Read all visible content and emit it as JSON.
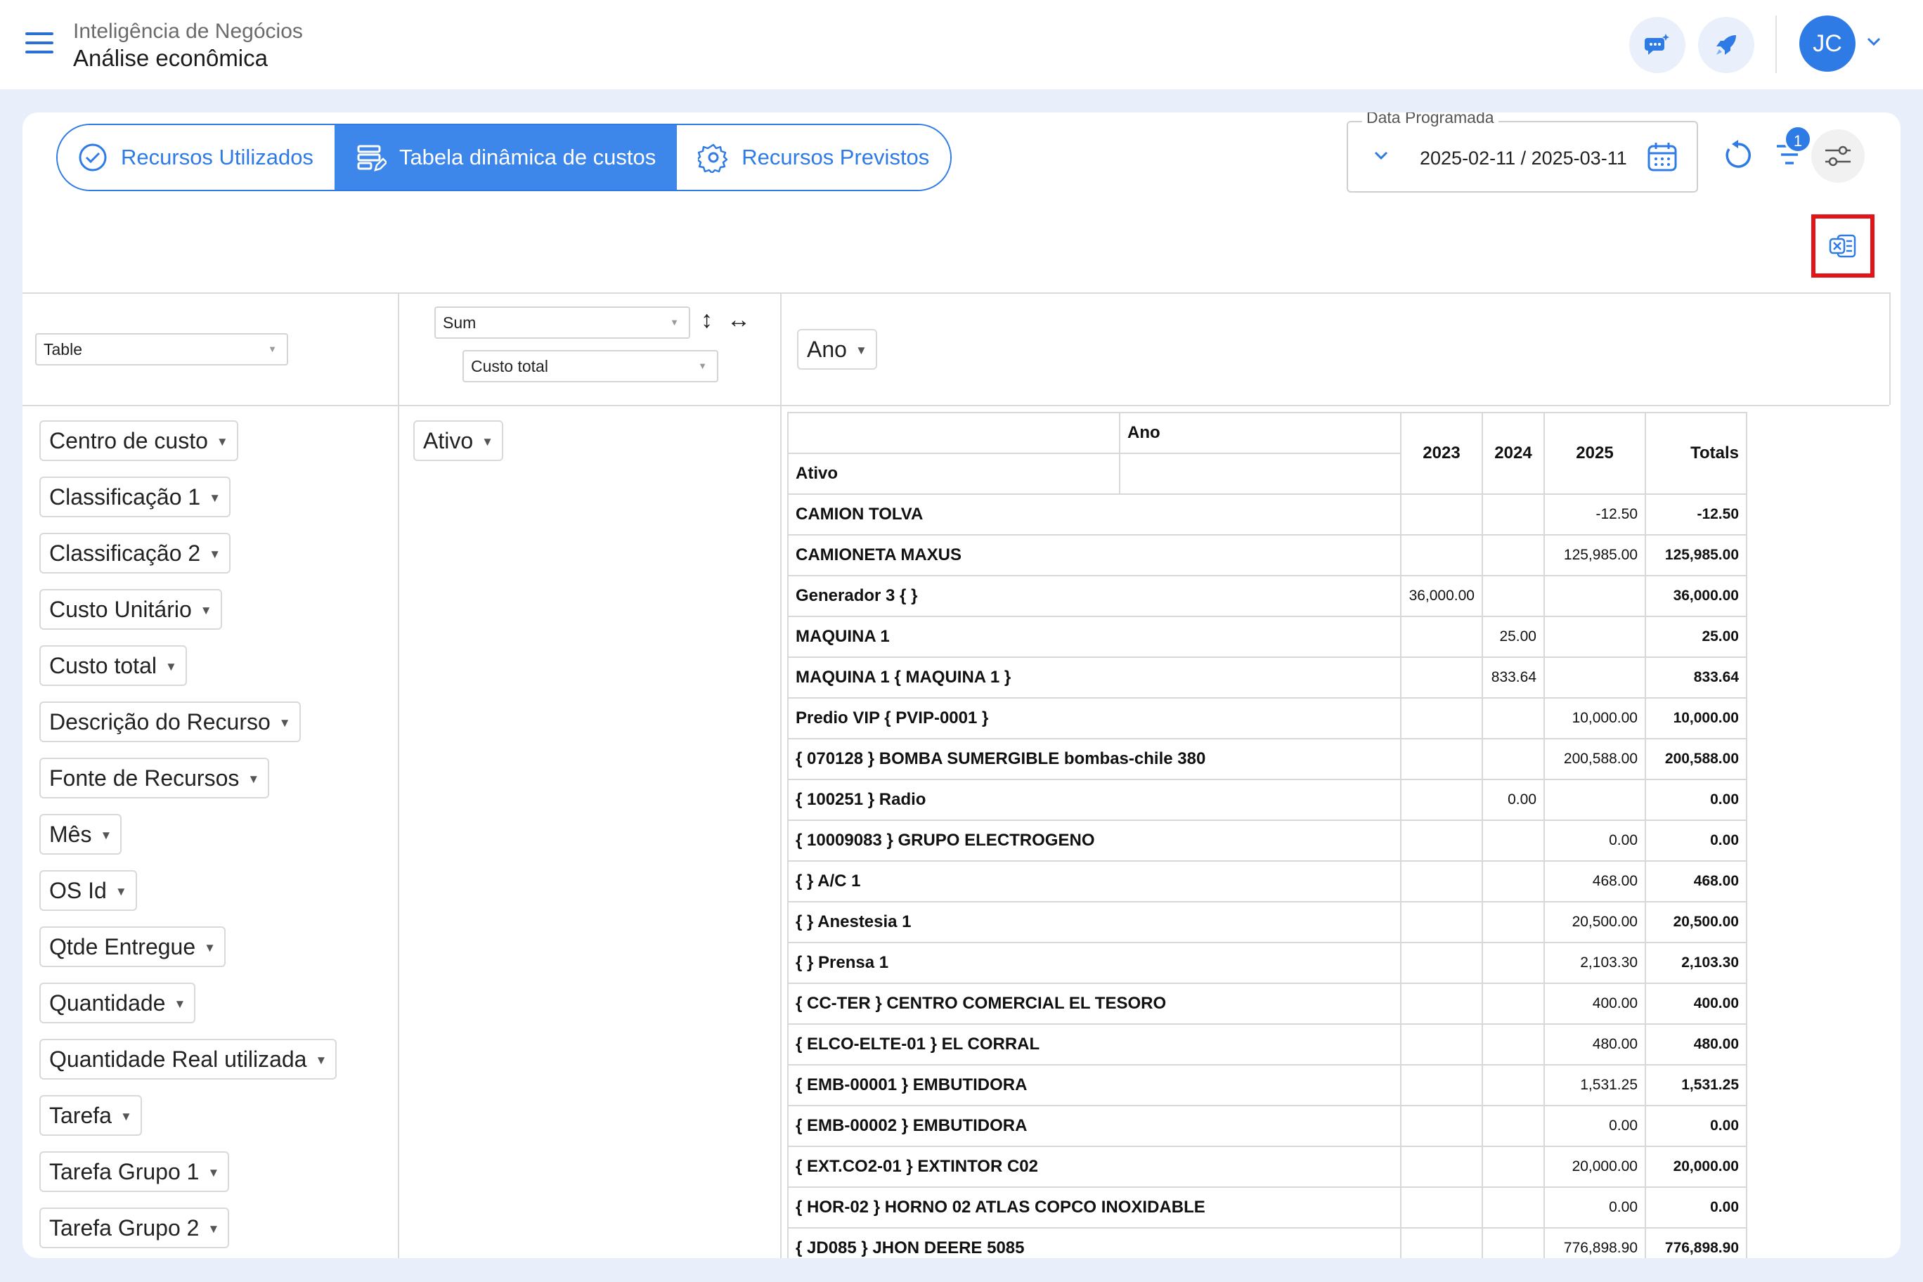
{
  "header": {
    "subtitle": "Inteligência de Negócios",
    "title": "Análise econômica",
    "avatar_initials": "JC"
  },
  "tabs": [
    {
      "label": "Recursos Utilizados",
      "icon": "check-circle-icon",
      "active": false
    },
    {
      "label": "Tabela dinâmica de custos",
      "icon": "table-edit-icon",
      "active": true
    },
    {
      "label": "Recursos Previstos",
      "icon": "gear-icon",
      "active": false
    }
  ],
  "date_filter": {
    "label": "Data Programada",
    "value": "2025-02-11 / 2025-03-11"
  },
  "filter_badge": "1",
  "pivot": {
    "renderer": "Table",
    "aggregator": "Sum",
    "value_field": "Custo total",
    "column_field": "Ano",
    "row_field": "Ativo",
    "available_fields": [
      "Centro de custo",
      "Classificação 1",
      "Classificação 2",
      "Custo Unitário",
      "Custo total",
      "Descrição do Recurso",
      "Fonte de Recursos",
      "Mês",
      "OS Id",
      "Qtde Entregue",
      "Quantidade",
      "Quantidade Real utilizada",
      "Tarefa",
      "Tarefa Grupo 1",
      "Tarefa Grupo 2"
    ]
  },
  "table": {
    "col_attr_label": "Ano",
    "row_attr_label": "Ativo",
    "columns": [
      "2023",
      "2024",
      "2025"
    ],
    "totals_label": "Totals",
    "rows": [
      {
        "label": "CAMION TOLVA",
        "v2023": "",
        "v2024": "",
        "v2025": "-12.50",
        "total": "-12.50"
      },
      {
        "label": "CAMIONETA MAXUS",
        "v2023": "",
        "v2024": "",
        "v2025": "125,985.00",
        "total": "125,985.00"
      },
      {
        "label": "Generador 3 { }",
        "v2023": "36,000.00",
        "v2024": "",
        "v2025": "",
        "total": "36,000.00"
      },
      {
        "label": "MAQUINA 1",
        "v2023": "",
        "v2024": "25.00",
        "v2025": "",
        "total": "25.00"
      },
      {
        "label": "MAQUINA 1 { MAQUINA 1 }",
        "v2023": "",
        "v2024": "833.64",
        "v2025": "",
        "total": "833.64"
      },
      {
        "label": "Predio VIP { PVIP-0001 }",
        "v2023": "",
        "v2024": "",
        "v2025": "10,000.00",
        "total": "10,000.00"
      },
      {
        "label": "{ 070128 } BOMBA SUMERGIBLE bombas-chile 380",
        "v2023": "",
        "v2024": "",
        "v2025": "200,588.00",
        "total": "200,588.00"
      },
      {
        "label": "{ 100251 } Radio",
        "v2023": "",
        "v2024": "0.00",
        "v2025": "",
        "total": "0.00"
      },
      {
        "label": "{ 10009083 } GRUPO ELECTROGENO",
        "v2023": "",
        "v2024": "",
        "v2025": "0.00",
        "total": "0.00"
      },
      {
        "label": "{ } A/C 1",
        "v2023": "",
        "v2024": "",
        "v2025": "468.00",
        "total": "468.00"
      },
      {
        "label": "{ } Anestesia 1",
        "v2023": "",
        "v2024": "",
        "v2025": "20,500.00",
        "total": "20,500.00"
      },
      {
        "label": "{ } Prensa 1",
        "v2023": "",
        "v2024": "",
        "v2025": "2,103.30",
        "total": "2,103.30"
      },
      {
        "label": "{ CC-TER } CENTRO COMERCIAL EL TESORO",
        "v2023": "",
        "v2024": "",
        "v2025": "400.00",
        "total": "400.00"
      },
      {
        "label": "{ ELCO-ELTE-01 } EL CORRAL",
        "v2023": "",
        "v2024": "",
        "v2025": "480.00",
        "total": "480.00"
      },
      {
        "label": "{ EMB-00001 } EMBUTIDORA",
        "v2023": "",
        "v2024": "",
        "v2025": "1,531.25",
        "total": "1,531.25"
      },
      {
        "label": "{ EMB-00002 } EMBUTIDORA",
        "v2023": "",
        "v2024": "",
        "v2025": "0.00",
        "total": "0.00"
      },
      {
        "label": "{ EXT.CO2-01 } EXTINTOR C02",
        "v2023": "",
        "v2024": "",
        "v2025": "20,000.00",
        "total": "20,000.00"
      },
      {
        "label": "{ HOR-02 } HORNO 02 ATLAS COPCO INOXIDABLE",
        "v2023": "",
        "v2024": "",
        "v2025": "0.00",
        "total": "0.00"
      },
      {
        "label": "{ JD085 } JHON DEERE 5085",
        "v2023": "",
        "v2024": "",
        "v2025": "776,898.90",
        "total": "776,898.90"
      }
    ]
  }
}
